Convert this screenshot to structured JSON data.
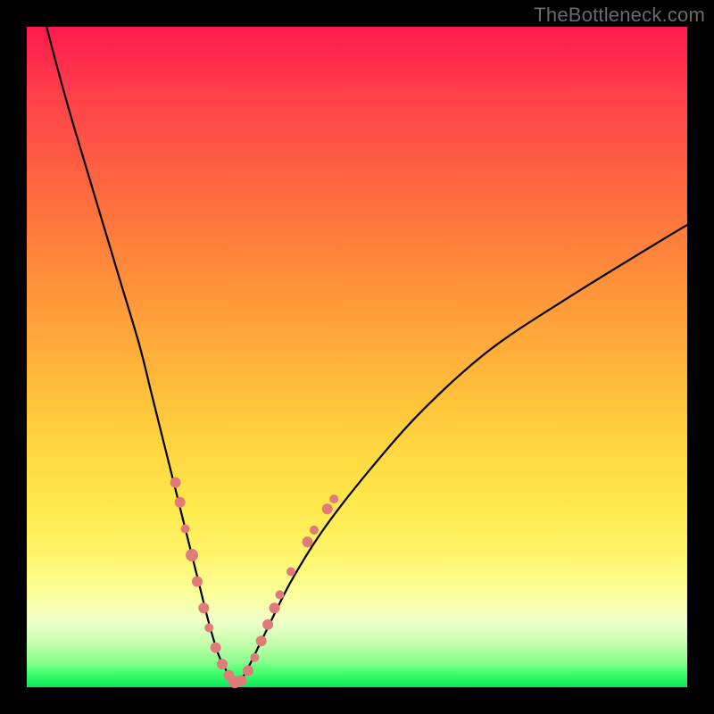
{
  "watermark": "TheBottleneck.com",
  "colors": {
    "background": "#000000",
    "curve": "#000000",
    "marker": "#e17b7a",
    "gradient_top": "#ff1a4d",
    "gradient_bottom": "#08e65a"
  },
  "chart_data": {
    "type": "line",
    "title": "",
    "xlabel": "",
    "ylabel": "",
    "xlim": [
      0,
      100
    ],
    "ylim": [
      0,
      100
    ],
    "series": [
      {
        "name": "bottleneck-curve",
        "x": [
          3,
          5,
          8,
          11,
          14,
          17,
          19,
          21,
          23,
          24.5,
          26,
          27.5,
          29,
          30.5,
          31.5,
          33,
          36,
          40,
          45,
          52,
          60,
          70,
          82,
          95,
          100
        ],
        "y": [
          100,
          92,
          82,
          72,
          62,
          52,
          44,
          36,
          28,
          22,
          16,
          10,
          5,
          2,
          0.5,
          2,
          8,
          16,
          24,
          33,
          42,
          51,
          59,
          67,
          70
        ]
      }
    ],
    "markers": {
      "name": "highlight-dots",
      "points": [
        {
          "x": 22.5,
          "y": 31,
          "r": 6
        },
        {
          "x": 23.2,
          "y": 28,
          "r": 6
        },
        {
          "x": 24.0,
          "y": 24,
          "r": 5
        },
        {
          "x": 25.0,
          "y": 20,
          "r": 7
        },
        {
          "x": 25.8,
          "y": 16,
          "r": 6
        },
        {
          "x": 26.8,
          "y": 12,
          "r": 6
        },
        {
          "x": 27.6,
          "y": 9,
          "r": 5
        },
        {
          "x": 28.6,
          "y": 6,
          "r": 6
        },
        {
          "x": 29.6,
          "y": 3.5,
          "r": 6
        },
        {
          "x": 30.6,
          "y": 1.8,
          "r": 6
        },
        {
          "x": 31.5,
          "y": 0.8,
          "r": 7
        },
        {
          "x": 32.5,
          "y": 1.0,
          "r": 6
        },
        {
          "x": 33.5,
          "y": 2.5,
          "r": 6
        },
        {
          "x": 34.5,
          "y": 4.5,
          "r": 5
        },
        {
          "x": 35.5,
          "y": 7.0,
          "r": 6
        },
        {
          "x": 36.5,
          "y": 9.5,
          "r": 6
        },
        {
          "x": 37.5,
          "y": 12.0,
          "r": 6
        },
        {
          "x": 38.3,
          "y": 14.0,
          "r": 5
        },
        {
          "x": 40.0,
          "y": 17.5,
          "r": 5
        },
        {
          "x": 42.5,
          "y": 22.0,
          "r": 6
        },
        {
          "x": 43.5,
          "y": 23.8,
          "r": 5
        },
        {
          "x": 45.5,
          "y": 27.0,
          "r": 6
        },
        {
          "x": 46.5,
          "y": 28.5,
          "r": 5
        }
      ]
    }
  }
}
